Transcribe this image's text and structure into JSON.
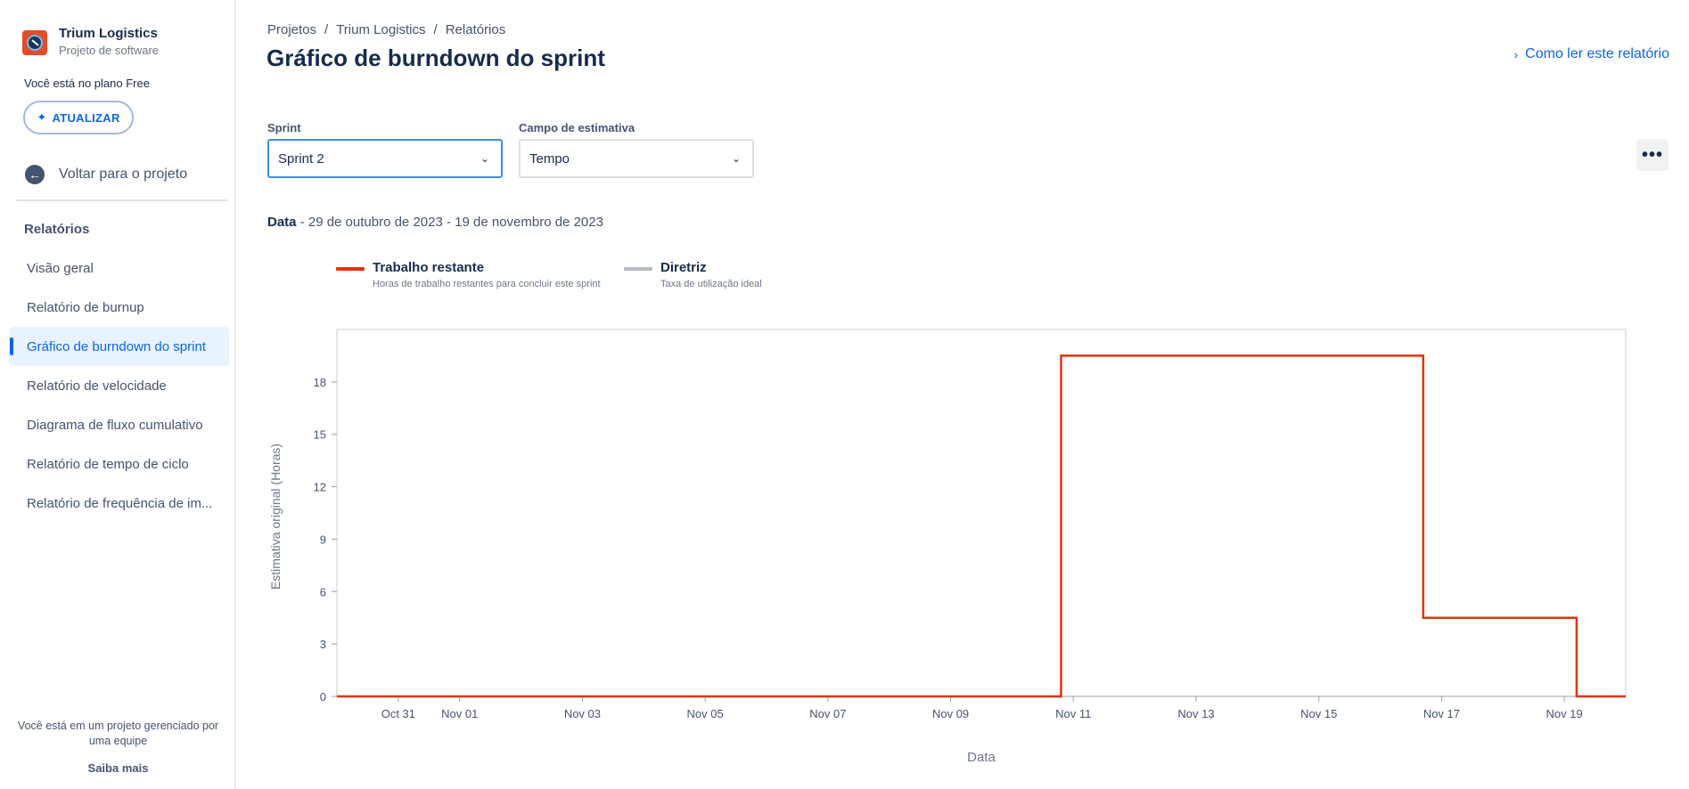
{
  "sidebar": {
    "project_name": "Trium Logistics",
    "project_type": "Projeto de software",
    "plan_text": "Você está no plano Free",
    "upgrade_label": "ATUALIZAR",
    "back_label": "Voltar para o projeto",
    "section_title": "Relatórios",
    "items": [
      {
        "label": "Visão geral"
      },
      {
        "label": "Relatório de burnup"
      },
      {
        "label": "Gráfico de burndown do sprint"
      },
      {
        "label": "Relatório de velocidade"
      },
      {
        "label": "Diagrama de fluxo cumulativo"
      },
      {
        "label": "Relatório de tempo de ciclo"
      },
      {
        "label": "Relatório de frequência de im..."
      }
    ],
    "active_index": 2,
    "managed_text": "Você está em um projeto gerenciado por uma equipe",
    "learn_more": "Saiba mais"
  },
  "header": {
    "breadcrumbs": [
      "Projetos",
      "Trium Logistics",
      "Relatórios"
    ],
    "title": "Gráfico de burndown do sprint",
    "how_to_read": "Como ler este relatório"
  },
  "filters": {
    "sprint_label": "Sprint",
    "sprint_value": "Sprint 2",
    "estimate_label": "Campo de estimativa",
    "estimate_value": "Tempo"
  },
  "date_range": {
    "label": "Data",
    "value": " - 29 de outubro de 2023 - 19 de novembro de 2023"
  },
  "legend": {
    "remaining_title": "Trabalho restante",
    "remaining_sub": "Horas de trabalho restantes para concluir este sprint",
    "guideline_title": "Diretriz",
    "guideline_sub": "Taxa de utilização ideal"
  },
  "colors": {
    "remaining": "#de350b",
    "guideline": "#b3bac5",
    "accent": "#0c66e4"
  },
  "chart_data": {
    "type": "line",
    "title": "",
    "xlabel": "Data",
    "ylabel": "Estimativa original (Horas)",
    "x_ticks": [
      "Oct 31",
      "Nov 01",
      "Nov 03",
      "Nov 05",
      "Nov 07",
      "Nov 09",
      "Nov 11",
      "Nov 13",
      "Nov 15",
      "Nov 17",
      "Nov 19"
    ],
    "y_ticks": [
      0,
      3,
      6,
      9,
      12,
      15,
      18
    ],
    "ylim": [
      0,
      21
    ],
    "x_range_days": [
      "2023-10-30",
      "2023-11-20"
    ],
    "grid": false,
    "legend_position": "top-left",
    "series": [
      {
        "name": "Trabalho restante",
        "step": true,
        "points": [
          {
            "x": "2023-10-30",
            "y": 0
          },
          {
            "x": "2023-11-10.8",
            "y": 0
          },
          {
            "x": "2023-11-10.8",
            "y": 19.5
          },
          {
            "x": "2023-11-16.7",
            "y": 19.5
          },
          {
            "x": "2023-11-16.7",
            "y": 4.5
          },
          {
            "x": "2023-11-19.2",
            "y": 4.5
          },
          {
            "x": "2023-11-19.2",
            "y": 0
          },
          {
            "x": "2023-11-20",
            "y": 0
          }
        ]
      }
    ]
  }
}
